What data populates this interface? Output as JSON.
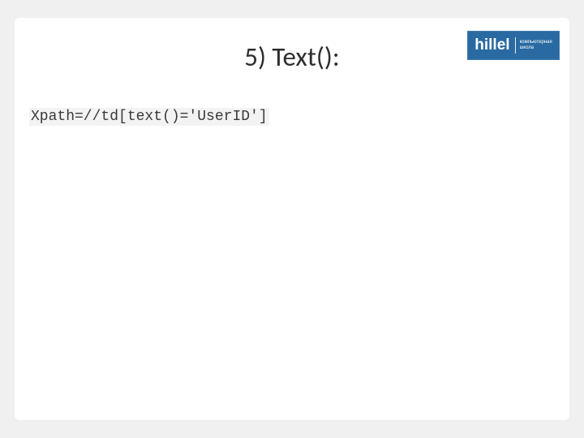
{
  "slide": {
    "title": "5) Text():",
    "code": "Xpath=//td[text()='UserID']"
  },
  "logo": {
    "brand": "hillel",
    "line1": "компьютерная",
    "line2": "школа"
  }
}
